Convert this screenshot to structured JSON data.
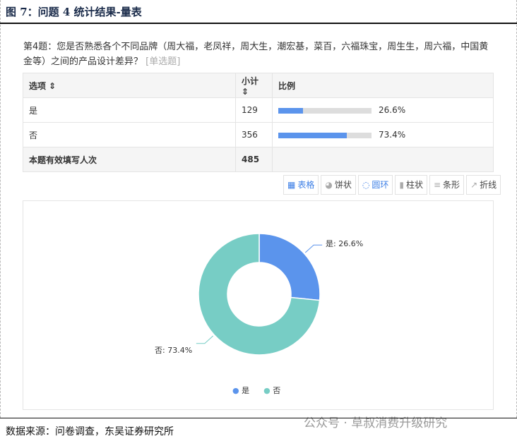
{
  "figure_title": "图 7：问题 4 统计结果-量表",
  "question": {
    "text": "第4题：您是否熟悉各个不同品牌（周大福，老凤祥，周大生，潮宏基，菜百，六福珠宝，周生生，周六福，中国黄金等）之间的产品设计差异？",
    "tag": "[单选题]"
  },
  "table": {
    "headers": [
      "选项 ⇕",
      "小计 ⇕",
      "比例"
    ],
    "rows": [
      {
        "option": "是",
        "count": "129",
        "pct": "26.6%",
        "value": 26.6
      },
      {
        "option": "否",
        "count": "356",
        "pct": "73.4%",
        "value": 73.4
      }
    ],
    "total": {
      "label": "本题有效填写人次",
      "count": "485"
    }
  },
  "view_buttons": [
    {
      "label": "表格",
      "icon": "table-icon",
      "active": true
    },
    {
      "label": "饼状",
      "icon": "pie-icon"
    },
    {
      "label": "圆环",
      "icon": "donut-icon",
      "active": true
    },
    {
      "label": "柱状",
      "icon": "bar-chart-icon"
    },
    {
      "label": "条形",
      "icon": "hbar-icon"
    },
    {
      "label": "折线",
      "icon": "line-icon"
    }
  ],
  "chart_data": {
    "type": "pie",
    "variant": "donut",
    "categories": [
      "是",
      "否"
    ],
    "values": [
      26.6,
      73.4
    ],
    "data_labels": [
      "是: 26.6%",
      "否: 73.4%"
    ],
    "colors": [
      "#5b94ec",
      "#77cdc5"
    ],
    "legend": "bottom"
  },
  "footer": "数据来源：问卷调查，东吴证券研究所",
  "watermark": "公众号 · 草叔消费升级研究"
}
